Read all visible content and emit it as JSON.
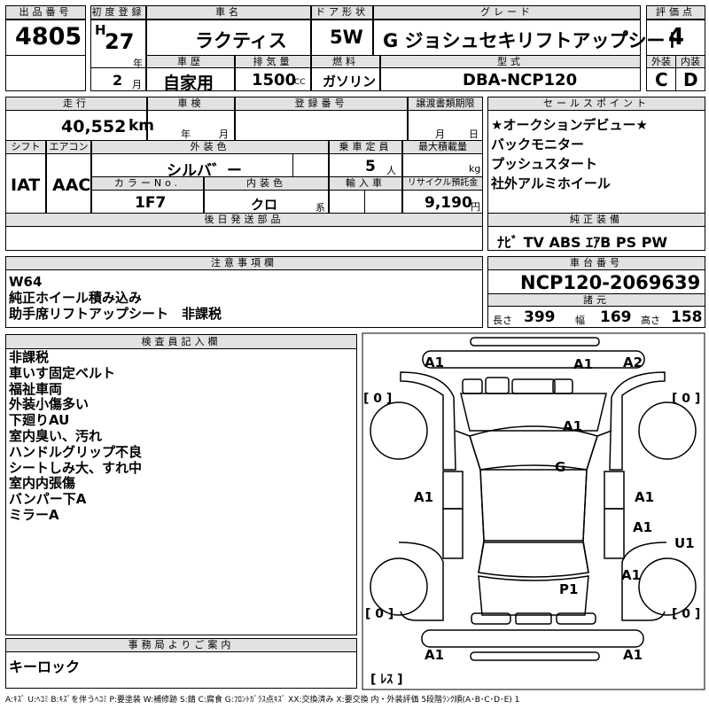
{
  "headers": {
    "lot": "出品番号",
    "first_reg": "初度登録",
    "car_name": "車名",
    "door": "ドア形状",
    "grade": "グレード",
    "score": "評価点",
    "history": "車歴",
    "displacement": "排気量",
    "fuel": "燃料",
    "model": "型式",
    "exterior": "外装",
    "interior": "内装",
    "mileage": "走行",
    "inspection": "車検",
    "reg_no": "登録番号",
    "manual": "譲渡書類期限",
    "selling": "セールスポイント",
    "shift": "シフト",
    "aircon": "エアコン",
    "ext_color": "外装色",
    "capacity": "乗車定員",
    "max_load": "最大積載量",
    "color_no": "カラーNo.",
    "int_color": "内装色",
    "import": "輸入車",
    "recycle": "リサイクル預託金",
    "later_parts": "後日発送部品",
    "genuine": "純正装備",
    "notes": "注意事項欄",
    "chassis": "車台番号",
    "specs": "諸元",
    "inspector": "検査員記入欄",
    "office": "事務局よりご案内"
  },
  "values": {
    "lot": "4805",
    "era": "H",
    "year": "27",
    "year_unit": "年",
    "month": "2",
    "month_unit": "月",
    "car_name": "ラクティス",
    "door": "5W",
    "grade": "G ジョシュセキリフトアップ゚シート",
    "score": "4",
    "history": "自家用",
    "displacement": "1500",
    "cc": "CC",
    "fuel": "ガソリン",
    "model": "DBA-NCP120",
    "exterior": "C",
    "interior": "D",
    "mileage": "40,552",
    "km": "km",
    "insp_year": "年",
    "insp_month": "月",
    "manual_month": "月",
    "manual_day": "日",
    "shift": "IAT",
    "aircon": "AAC",
    "ext_color": "シルバ゛ー",
    "capacity": "5",
    "person": "人",
    "kg": "kg",
    "color_no": "1F7",
    "int_color": "クロ",
    "kei": "系",
    "recycle": "9,190",
    "yen": "円",
    "genuine": "ﾅﾋﾞ TV ABS ｴｱB PS PW",
    "chassis": "NCP120-2069639",
    "len_label": "長さ",
    "length": "399",
    "wid_label": "幅",
    "width": "169",
    "hgt_label": "高さ",
    "height": "158",
    "office_note": "キーロック"
  },
  "sales_points": [
    "★オークションデビュー★",
    "バックモニター",
    "プッシュスタート",
    "社外アルミホイール"
  ],
  "notes": [
    "W64",
    "純正ホイール積み込み",
    "助手席リフトアップシート　非課税"
  ],
  "inspector_notes": [
    "非課税",
    "車いす固定ベルト",
    "福祉車両",
    "外装小傷多い",
    "下廻りAU",
    "室内臭い、汚れ",
    "ハンドルグリップ不良",
    "シートしみ大、すれ中",
    "室内内張傷",
    "バンパー下A",
    "ミラーA"
  ],
  "diagram": {
    "marks": {
      "fl_bumper": "A1",
      "fr_bumper": "A2",
      "bonnet": "A1",
      "roof": "G",
      "left_front_door": "A1",
      "right_front_door": "A1",
      "right_rear_door": "A1",
      "right_rear_fender": "A1",
      "right_wheel": "U1",
      "tailgate": "P1",
      "rl_bumper": "A1",
      "rr_bumper": "A1"
    },
    "tires": {
      "fl": "[ 0 ]",
      "fr": "[ 0 ]",
      "rl": "[ 0 ]",
      "rr": "[ 0 ]"
    },
    "spare": "[ ﾚｽ ]"
  },
  "legend": "A:ｷｽﾞ U:ﾍｺﾐ B:ｷｽﾞを伴うﾍｺﾐ P:要塗装 W:補修跡 S:錆 C:腐食 G:ﾌﾛﾝﾄｶﾞﾗｽ点ｷｽﾞ XX:交換済み X:要交換 内・外装評価 5段階ﾗﾝｸ順(A･B･C･D･E) 1"
}
